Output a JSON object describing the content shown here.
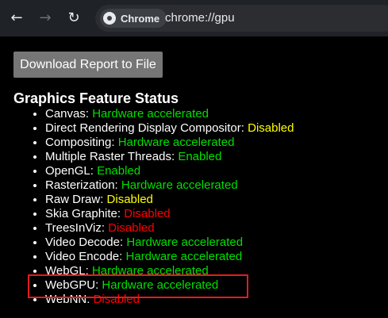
{
  "browser": {
    "chip_label": "Chrome",
    "url": "chrome://gpu",
    "back_icon": "arrow-left",
    "forward_icon": "arrow-right",
    "reload_icon": "reload"
  },
  "download_button": {
    "label": "Download Report to File"
  },
  "section_title": "Graphics Feature Status",
  "colors": {
    "enabled": "#00e000",
    "warning": "#ffff00",
    "disabled": "#ff0000",
    "highlight": "#e11d1d"
  },
  "features": [
    {
      "name": "Canvas",
      "status": "Hardware accelerated"
    },
    {
      "name": "Direct Rendering Display Compositor",
      "status": "Disabled"
    },
    {
      "name": "Compositing",
      "status": "Hardware accelerated"
    },
    {
      "name": "Multiple Raster Threads",
      "status": "Enabled"
    },
    {
      "name": "OpenGL",
      "status": "Enabled"
    },
    {
      "name": "Rasterization",
      "status": "Hardware accelerated"
    },
    {
      "name": "Raw Draw",
      "status": "Disabled"
    },
    {
      "name": "Skia Graphite",
      "status": "Disabled"
    },
    {
      "name": "TreesInViz",
      "status": "Disabled"
    },
    {
      "name": "Video Decode",
      "status": "Hardware accelerated"
    },
    {
      "name": "Video Encode",
      "status": "Hardware accelerated"
    },
    {
      "name": "WebGL",
      "status": "Hardware accelerated"
    },
    {
      "name": "WebGPU",
      "status": "Hardware accelerated"
    },
    {
      "name": "WebNN",
      "status": "Disabled"
    }
  ]
}
